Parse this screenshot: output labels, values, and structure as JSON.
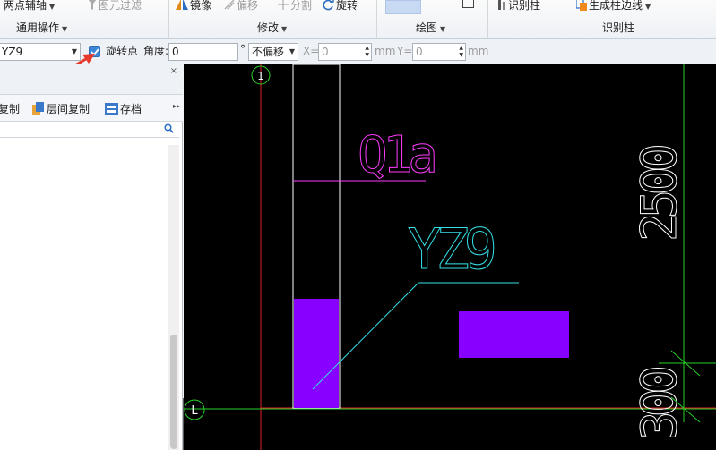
{
  "ribbon": {
    "groups": [
      {
        "label": "通用操作",
        "items": [
          "两点辅轴"
        ]
      },
      {
        "label": "修改",
        "items": [
          "镜像",
          "偏移",
          "分割",
          "旋转"
        ]
      },
      {
        "label": "绘图",
        "items": []
      },
      {
        "label": "识别柱",
        "items": [
          "识别柱",
          "生成柱边线"
        ]
      }
    ],
    "filter_label": "图元过滤"
  },
  "option_bar": {
    "component_value": "YZ9",
    "rotate_point_label": "旋转点",
    "rotate_point_checked": true,
    "angle_label": "角度:",
    "angle_value": "0",
    "degree_unit": "°",
    "offset_mode": "不偏移",
    "x_label": "X=",
    "x_value": "0",
    "x_unit": "mm",
    "y_label": "Y=",
    "y_value": "0",
    "y_unit": "mm"
  },
  "left_panel": {
    "tools": [
      "复制",
      "层间复制",
      "存档"
    ],
    "close_glyph": "×",
    "more_glyph": "▸▸"
  },
  "drawing": {
    "axis_top_label": "1",
    "axis_left_label": "L",
    "wall_label": "Q1a",
    "column_label": "YZ9",
    "dim_top": "2500",
    "dim_bottom": "300",
    "colors": {
      "background": "#000000",
      "axis_red": "#e02020",
      "axis_green": "#27d327",
      "wall": "#ffffff",
      "wall_text": "#ff3cff",
      "column_fill": "#8800ff",
      "label_cyan": "#33e0e6",
      "dim_white": "#ffffff"
    }
  }
}
